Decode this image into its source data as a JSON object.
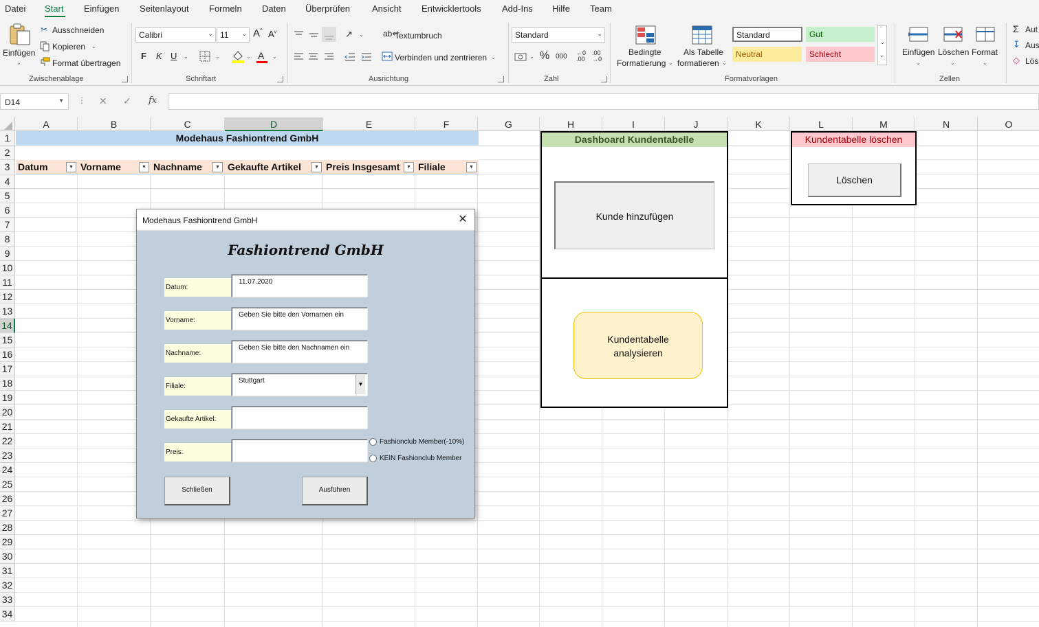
{
  "menu": {
    "tabs": [
      "Datei",
      "Start",
      "Einfügen",
      "Seitenlayout",
      "Formeln",
      "Daten",
      "Überprüfen",
      "Ansicht",
      "Entwicklertools",
      "Add-Ins",
      "Hilfe",
      "Team"
    ]
  },
  "ribbon": {
    "clipboard": {
      "paste": "Einfügen",
      "cut": "Ausschneiden",
      "copy": "Kopieren",
      "format_painter": "Format übertragen",
      "group": "Zwischenablage"
    },
    "font": {
      "name": "Calibri",
      "size": "11",
      "bold": "F",
      "italic": "K",
      "underline": "U",
      "group": "Schriftart"
    },
    "alignment": {
      "wrap": "Textumbruch",
      "merge": "Verbinden und zentrieren",
      "group": "Ausrichtung"
    },
    "number": {
      "format": "Standard",
      "percent": "%",
      "thousands": "000",
      "group": "Zahl"
    },
    "styles": {
      "conditional_line1": "Bedingte",
      "conditional_line2": "Formatierung",
      "as_table_line1": "Als Tabelle",
      "as_table_line2": "formatieren",
      "cell_standard": "Standard",
      "cell_good": "Gut",
      "cell_neutral": "Neutral",
      "cell_bad": "Schlecht",
      "group": "Formatvorlagen"
    },
    "cells": {
      "insert": "Einfügen",
      "delete": "Löschen",
      "format": "Format",
      "group": "Zellen"
    },
    "editing": {
      "autosum": "Aut",
      "fill": "Aus",
      "clear": "Lös"
    }
  },
  "formula_bar": {
    "name_box": "D14",
    "fx": "fx",
    "value": ""
  },
  "grid": {
    "columns": [
      "A",
      "B",
      "C",
      "D",
      "E",
      "F",
      "G",
      "H",
      "I",
      "J",
      "K",
      "L",
      "M",
      "N",
      "O"
    ],
    "rows": [
      "1",
      "2",
      "3",
      "4",
      "5",
      "6",
      "7",
      "8",
      "9",
      "10",
      "11",
      "12",
      "13",
      "14",
      "15",
      "16",
      "17",
      "18",
      "19",
      "20",
      "21",
      "22",
      "23",
      "24",
      "25",
      "26",
      "27",
      "28",
      "29",
      "30",
      "31",
      "32",
      "33",
      "34"
    ],
    "selected_column": "D",
    "selected_row": "14"
  },
  "sheet": {
    "title": "Modehaus Fashiontrend GmbH",
    "headers": [
      "Datum",
      "Vorname",
      "Nachname",
      "Gekaufte Artikel",
      "Preis Insgesamt",
      "Filiale"
    ],
    "dashboard": {
      "title": "Dashboard Kundentabelle",
      "add_button": "Kunde hinzufügen",
      "analyze_line1": "Kundentabelle",
      "analyze_line2": "analysieren"
    },
    "delete_panel": {
      "title": "Kundentabelle löschen",
      "button": "Löschen"
    }
  },
  "dialog": {
    "title": "Modehaus Fashiontrend GmbH",
    "brand": "Fashiontrend GmbH",
    "fields": [
      {
        "label": "Datum:",
        "value": "11.07.2020"
      },
      {
        "label": "Vorname:",
        "value": "Geben Sie bitte den Vornamen ein"
      },
      {
        "label": "Nachname:",
        "value": "Geben Sie bitte den Nachnamen ein"
      },
      {
        "label": "Filiale:",
        "value": "Stuttgart"
      },
      {
        "label": "Gekaufte Artikel:",
        "value": ""
      },
      {
        "label": "Preis:",
        "value": ""
      }
    ],
    "radios": [
      "Fashionclub Member(-10%)",
      "KEIN Fashionclub Member"
    ],
    "close_button": "Schließen",
    "run_button": "Ausführen"
  },
  "colors": {
    "accent": "#107c41",
    "title_band": "#bdd7ee",
    "header_fill": "#fce4d6",
    "dashboard_title": "#c6e0b4",
    "delete_title": "#ffc7ce",
    "analyze_fill": "#fff2cc",
    "dialog_bg": "#c1cedc",
    "label_fill": "#ffffdf"
  }
}
